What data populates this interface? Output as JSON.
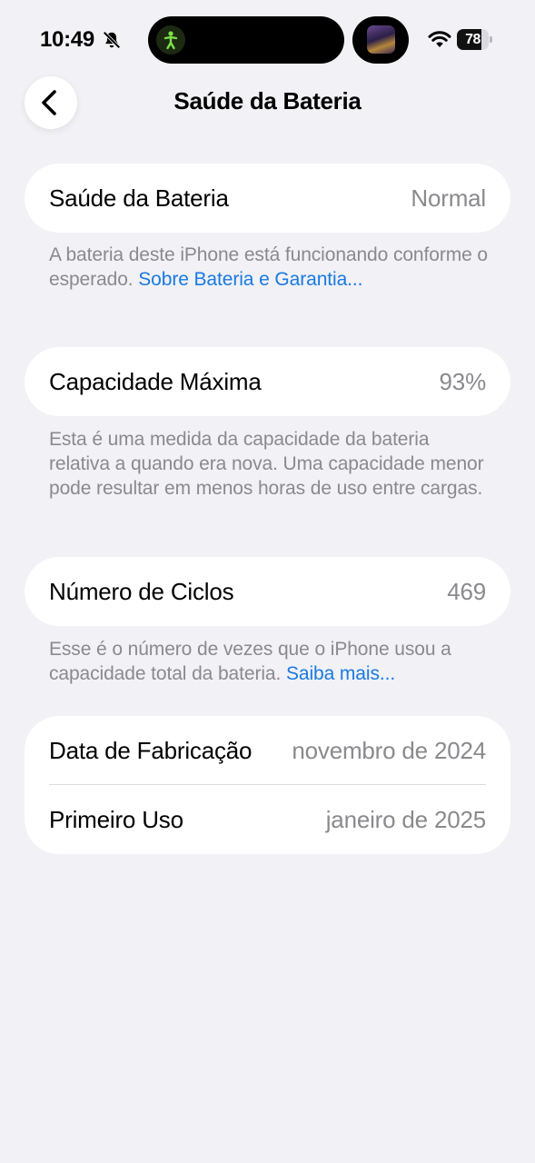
{
  "status_bar": {
    "time": "10:49",
    "battery_level": "78",
    "battery_fraction": 0.78,
    "icons": [
      "bell-slash-icon",
      "fitness-activity-icon",
      "now-playing-artwork",
      "wifi-icon",
      "battery-icon"
    ]
  },
  "nav": {
    "title": "Saúde da Bateria",
    "back_icon": "chevron-left-icon"
  },
  "sections": {
    "health": {
      "label": "Saúde da Bateria",
      "value": "Normal",
      "footnote": "A bateria deste iPhone está funcionando conforme o esperado. ",
      "link": "Sobre Bateria e Garantia..."
    },
    "capacity": {
      "label": "Capacidade Máxima",
      "value": "93%",
      "footnote": "Esta é uma medida da capacidade da bateria relativa a quando era nova. Uma capacidade menor pode resultar em menos horas de uso entre cargas."
    },
    "cycles": {
      "label": "Número de Ciclos",
      "value": "469",
      "footnote": "Esse é o número de vezes que o iPhone usou a capacidade total da bateria. ",
      "link": "Saiba mais..."
    },
    "dates": {
      "manufacture_label": "Data de Fabricação",
      "manufacture_value": "novembro de 2024",
      "first_use_label": "Primeiro Uso",
      "first_use_value": "janeiro de 2025"
    }
  },
  "colors": {
    "background": "#f1f1f6",
    "card": "#ffffff",
    "secondary_text": "#8a8a8e",
    "link": "#1a7ae0",
    "activity_green": "#7ee04a"
  }
}
